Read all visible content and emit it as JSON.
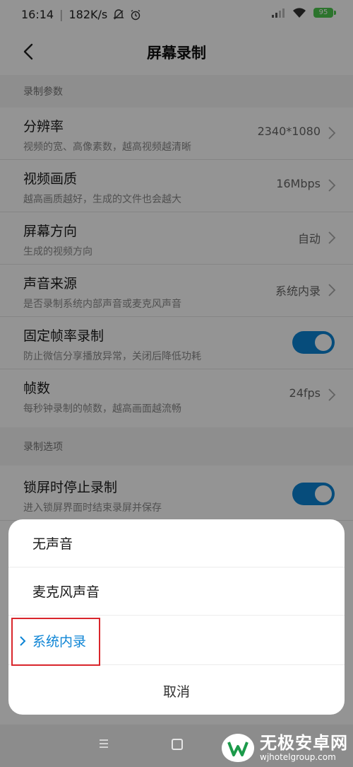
{
  "status_bar": {
    "time": "16:14",
    "separator": "|",
    "speed": "182K/s",
    "icons": [
      "mute-icon",
      "alarm-icon",
      "signal-icon",
      "wifi-icon",
      "battery-icon"
    ],
    "battery": "95"
  },
  "header": {
    "title": "屏幕录制",
    "back_icon": "back-arrow-icon"
  },
  "sections": [
    {
      "title": "录制参数",
      "rows": [
        {
          "title": "分辨率",
          "subtitle": "视频的宽、高像素数，越高视频越清晰",
          "value": "2340*1080"
        },
        {
          "title": "视频画质",
          "subtitle": "越高画质越好，生成的文件也会越大",
          "value": "16Mbps"
        },
        {
          "title": "屏幕方向",
          "subtitle": "生成的视频方向",
          "value": "自动"
        },
        {
          "title": "声音来源",
          "subtitle": "是否录制系统内部声音或麦克风声音",
          "value": "系统内录"
        },
        {
          "title": "固定帧率录制",
          "subtitle": "防止微信分享播放异常，关闭后降低功耗",
          "toggle": true
        },
        {
          "title": "帧数",
          "subtitle": "每秒钟录制的帧数，越高画面越流畅",
          "value": "24fps"
        }
      ]
    },
    {
      "title": "录制选项",
      "rows": [
        {
          "title": "锁屏时停止录制",
          "subtitle": "进入锁屏界面时结束录屏并保存",
          "toggle": true
        }
      ]
    }
  ],
  "sheet": {
    "options": [
      {
        "label": "无声音",
        "selected": false
      },
      {
        "label": "麦克风声音",
        "selected": false
      },
      {
        "label": "系统内录",
        "selected": true
      }
    ],
    "cancel": "取消"
  },
  "colors": {
    "accent": "#0c84d5",
    "highlight_border": "#d9262c",
    "battery": "#4cc84f"
  },
  "nav_bar": {
    "icons": [
      "menu-icon",
      "home-icon",
      "back-icon"
    ]
  },
  "watermark": {
    "title": "无极安卓网",
    "url": "wjhotelgroup.com"
  }
}
